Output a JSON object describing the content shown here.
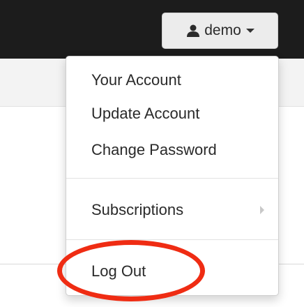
{
  "user_menu": {
    "button_label": "demo",
    "button_icon": "user-icon",
    "items": {
      "your_account": "Your Account",
      "update_account": "Update Account",
      "change_password": "Change Password",
      "subscriptions": "Subscriptions",
      "log_out": "Log Out"
    }
  },
  "colors": {
    "topbar": "#1c1c1c",
    "highlight": "#ef2c13"
  }
}
